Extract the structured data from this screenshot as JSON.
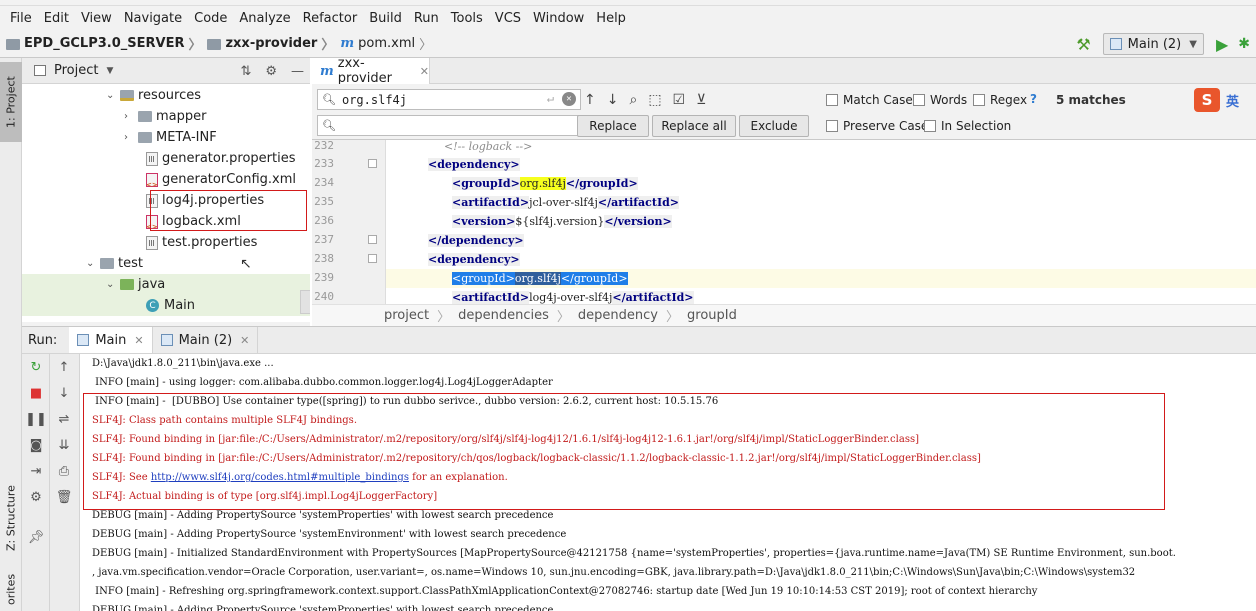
{
  "menu": [
    "File",
    "Edit",
    "View",
    "Navigate",
    "Code",
    "Analyze",
    "Refactor",
    "Build",
    "Run",
    "Tools",
    "VCS",
    "Window",
    "Help"
  ],
  "nav": {
    "project": "EPD_GCLP3.0_SERVER",
    "module": "zxx-provider",
    "file": "pom.xml",
    "run_config": "Main (2)"
  },
  "stripe": {
    "project": "1: Project",
    "structure": "Z: Structure",
    "favorites": "orites"
  },
  "project_panel": {
    "title": "Project"
  },
  "tree": [
    {
      "label": "resources",
      "kind": "res"
    },
    {
      "label": "mapper",
      "kind": "folder"
    },
    {
      "label": "META-INF",
      "kind": "folder"
    },
    {
      "label": "generator.properties",
      "kind": "prop"
    },
    {
      "label": "generatorConfig.xml",
      "kind": "xml"
    },
    {
      "label": "log4j.properties",
      "kind": "prop"
    },
    {
      "label": "logback.xml",
      "kind": "xml"
    },
    {
      "label": "test.properties",
      "kind": "prop"
    },
    {
      "label": "test",
      "kind": "folder"
    },
    {
      "label": "java",
      "kind": "green"
    },
    {
      "label": "Main",
      "kind": "class"
    }
  ],
  "editor_tab": {
    "label": "zxx-provider"
  },
  "find": {
    "query": "org.slf4j",
    "buttons": {
      "replace": "Replace",
      "replace_all": "Replace all",
      "exclude": "Exclude"
    },
    "options": {
      "match_case": "Match Case",
      "words": "Words",
      "regex": "Regex",
      "preserve_case": "Preserve Case",
      "in_selection": "In Selection"
    },
    "help": "?",
    "matches": "5 matches",
    "ime_logo": "S",
    "ime_lang": "英"
  },
  "code": {
    "line_numbers": [
      "232",
      "233",
      "234",
      "235",
      "236",
      "237",
      "238",
      "239",
      "240"
    ],
    "l232": "<!-- logback -->",
    "dep_tag": "dependency",
    "groupId_tag": "groupId",
    "artifactId_tag": "artifactId",
    "version_tag": "version",
    "match_text": "org.slf4j",
    "artifact1": "jcl-over-slf4j",
    "version1": "${slf4j.version}",
    "artifact2": "log4j-over-slf4j"
  },
  "editor_breadcrumb": [
    "project",
    "dependencies",
    "dependency",
    "groupId"
  ],
  "run": {
    "label": "Run:",
    "tabs": [
      "Main",
      "Main (2)"
    ]
  },
  "console": {
    "l1": "D:\\Java\\jdk1.8.0_211\\bin\\java.exe ...",
    "l2": " INFO [main] - using logger: com.alibaba.dubbo.common.logger.log4j.Log4jLoggerAdapter",
    "l3": " INFO [main] -  [DUBBO] Use container type([spring]) to run dubbo serivce., dubbo version: 2.6.2, current host: 10.5.15.76",
    "l4": "SLF4J: Class path contains multiple SLF4J bindings.",
    "l5": "SLF4J: Found binding in [jar:file:/C:/Users/Administrator/.m2/repository/org/slf4j/slf4j-log4j12/1.6.1/slf4j-log4j12-1.6.1.jar!/org/slf4j/impl/StaticLoggerBinder.class]",
    "l6": "SLF4J: Found binding in [jar:file:/C:/Users/Administrator/.m2/repository/ch/qos/logback/logback-classic/1.1.2/logback-classic-1.1.2.jar!/org/slf4j/impl/StaticLoggerBinder.class]",
    "l7_pre": "SLF4J: See ",
    "l7_link": "http://www.slf4j.org/codes.html#multiple_bindings",
    "l7_post": " for an explanation.",
    "l8": "SLF4J: Actual binding is of type [org.slf4j.impl.Log4jLoggerFactory]",
    "l9": "DEBUG [main] - Adding PropertySource 'systemProperties' with lowest search precedence",
    "l10": "DEBUG [main] - Adding PropertySource 'systemEnvironment' with lowest search precedence",
    "l11": "DEBUG [main] - Initialized StandardEnvironment with PropertySources [MapPropertySource@42121758 {name='systemProperties', properties={java.runtime.name=Java(TM) SE Runtime Environment, sun.boot.",
    "l12": ", java.vm.specification.vendor=Oracle Corporation, user.variant=, os.name=Windows 10, sun.jnu.encoding=GBK, java.library.path=D:\\Java\\jdk1.8.0_211\\bin;C:\\Windows\\Sun\\Java\\bin;C:\\Windows\\system32",
    "l13": " INFO [main] - Refreshing org.springframework.context.support.ClassPathXmlApplicationContext@27082746: startup date [Wed Jun 19 10:10:14:53 CST 2019]; root of context hierarchy",
    "l14": "DEBUG [main] - Adding PropertySource 'systemProperties' with lowest search precedence"
  }
}
